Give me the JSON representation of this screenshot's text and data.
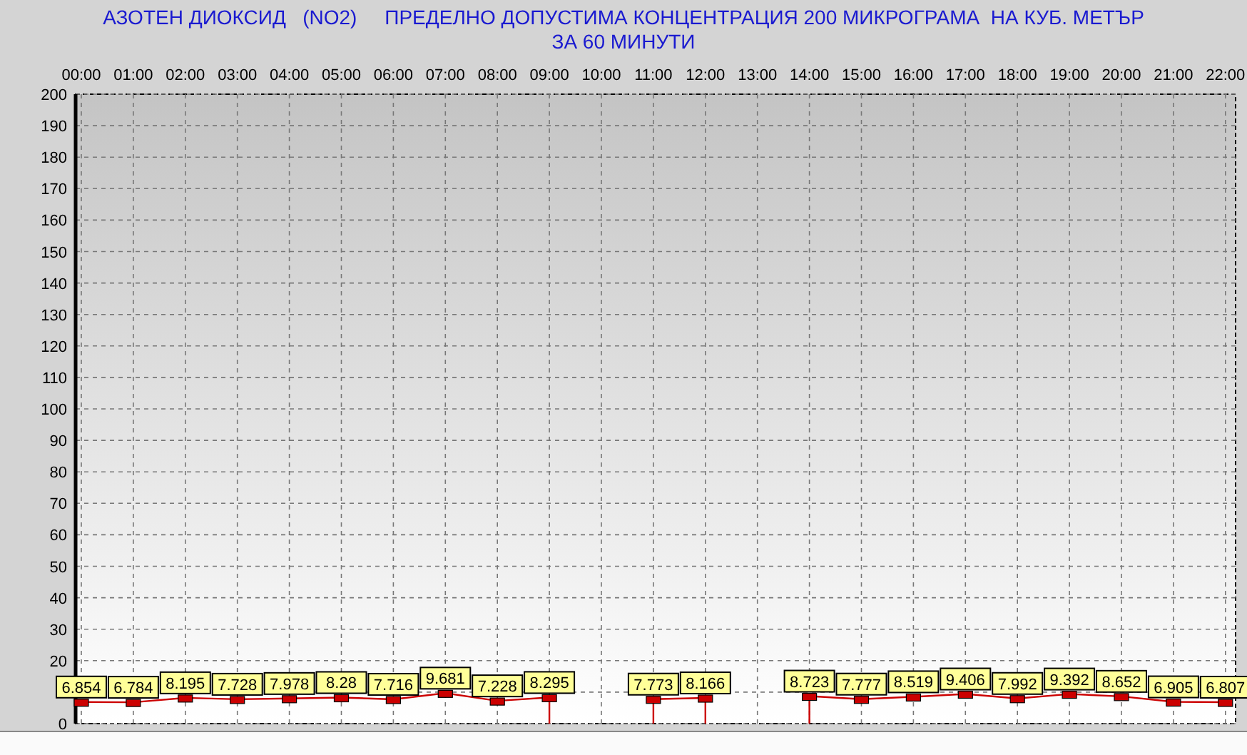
{
  "chart": {
    "title_lines": [
      "АЗОТЕН ДИОКСИД   (NO2)     ПРЕДЕЛНО ДОПУСТИМА КОНЦЕНТРАЦИЯ 200 МИКРОГРАМА  НА КУБ. МЕТЪР",
      "ЗА 60 МИНУТИ"
    ],
    "chart_data": {
      "type": "line",
      "categories": [
        "00:00",
        "01:00",
        "02:00",
        "03:00",
        "04:00",
        "05:00",
        "06:00",
        "07:00",
        "08:00",
        "09:00",
        "10:00",
        "11:00",
        "12:00",
        "13:00",
        "14:00",
        "15:00",
        "16:00",
        "17:00",
        "18:00",
        "19:00",
        "20:00",
        "21:00",
        "22:00"
      ],
      "grid": true,
      "series": [
        {
          "color": "#cc0000",
          "marker": "square",
          "values": [
            6.854,
            6.784,
            8.195,
            7.728,
            7.978,
            8.28,
            7.716,
            9.681,
            7.228,
            8.295,
            null,
            7.773,
            8.166,
            null,
            8.723,
            7.777,
            8.519,
            9.406,
            7.992,
            9.392,
            8.652,
            6.905,
            6.807
          ]
        }
      ],
      "value_labels": [
        "6.854",
        "6.784",
        "8.195",
        "7.728",
        "7.978",
        "8.28",
        "7.716",
        "9.681",
        "7.228",
        "8.295",
        null,
        "7.773",
        "8.166",
        null,
        "8.723",
        "7.777",
        "8.519",
        "9.406",
        "7.992",
        "9.392",
        "8.652",
        "6.905",
        "6.807"
      ],
      "ylim": [
        0,
        200
      ],
      "yticks": [
        0,
        20,
        30,
        40,
        50,
        60,
        70,
        80,
        90,
        100,
        110,
        120,
        130,
        140,
        150,
        160,
        170,
        180,
        190,
        200
      ]
    }
  }
}
